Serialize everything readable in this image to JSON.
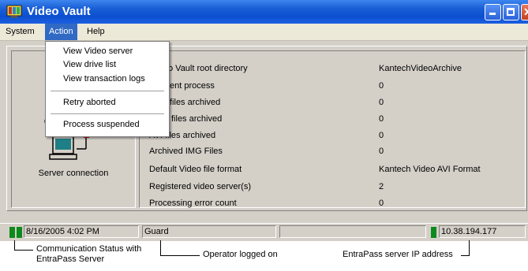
{
  "window": {
    "title": "Video Vault"
  },
  "menubar": {
    "items": [
      "System",
      "Action",
      "Help"
    ]
  },
  "action_menu": {
    "items": [
      "View Video server",
      "View drive list",
      "View transaction logs",
      "Retry aborted",
      "Process suspended"
    ]
  },
  "info_rows": [
    {
      "label": "Video Vault root directory",
      "label_visible": "o Vault root directory",
      "value": "KantechVideoArchive"
    },
    {
      "label": "Current process",
      "label_visible": "ent process",
      "value": "0"
    },
    {
      "label": "files archived",
      "label_visible": "files archived",
      "value": "0"
    },
    {
      "label": "files archived",
      "label_visible": "files archived",
      "value": "0"
    },
    {
      "label": "AVI files archived",
      "label_visible": "AVI files archived",
      "value": "0"
    },
    {
      "label": "Archived IMG Files",
      "label_visible": "Archived IMG Files",
      "value": "0"
    },
    {
      "label": "Default Video file format",
      "label_visible": "Default Video file format",
      "value": "Kantech Video AVI Format"
    },
    {
      "label": "Registered video server(s)",
      "label_visible": "Registered video server(s)",
      "value": "2"
    },
    {
      "label": "Processing error count",
      "label_visible": "Processing error count",
      "value": "0"
    }
  ],
  "server": {
    "label": "Server connection"
  },
  "status": {
    "datetime": "8/16/2005 4:02 PM",
    "operator": "Guard",
    "ip": "10.38.194.177",
    "led_color": "#0c8a1c"
  },
  "callouts": {
    "comm_status": "Communication Status with",
    "comm_status_line2": "EntraPass Server",
    "operator": "Operator logged on",
    "ip": "EntraPass server IP address"
  }
}
